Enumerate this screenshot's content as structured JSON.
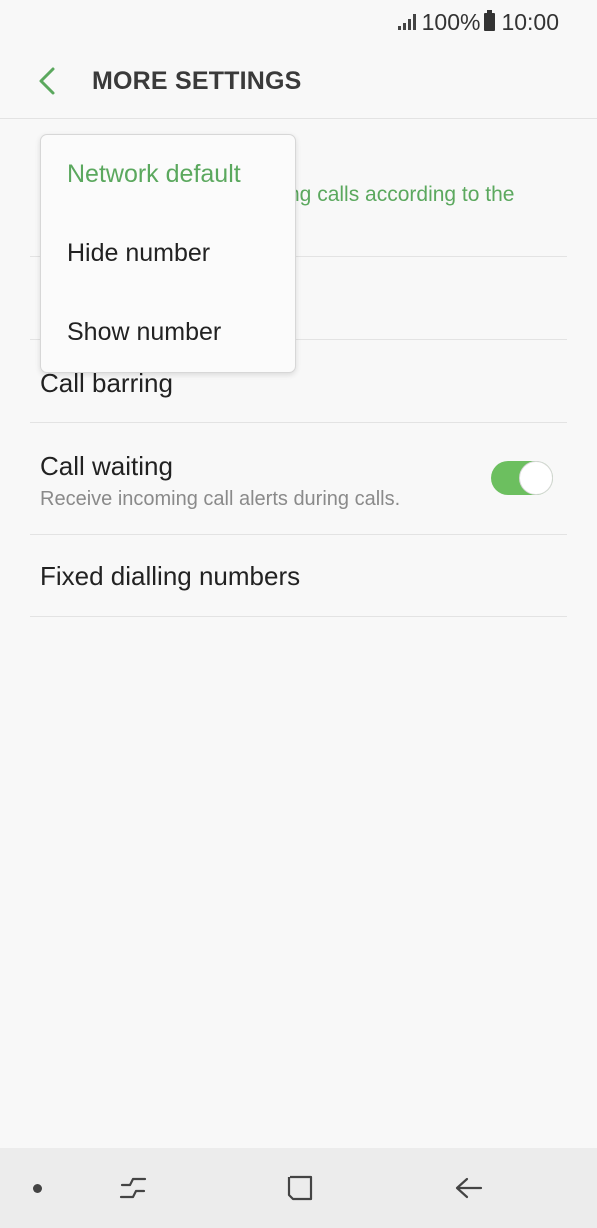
{
  "status_bar": {
    "battery": "100%",
    "time": "10:00"
  },
  "header": {
    "title": "MORE SETTINGS",
    "back_icon": "chevron-left-icon"
  },
  "settings": {
    "caller_id": {
      "subtitle_partial": "ng calls according to the"
    },
    "call_barring": {
      "title": "Call barring"
    },
    "call_waiting": {
      "title": "Call waiting",
      "subtitle": "Receive incoming call alerts during calls.",
      "enabled": true
    },
    "fixed_dialling": {
      "title": "Fixed dialling numbers"
    }
  },
  "dropdown": {
    "options": [
      "Network default",
      "Hide number",
      "Show number"
    ],
    "selected": "Network default"
  },
  "nav_bar": {
    "icons": [
      "recent-apps-icon",
      "home-icon",
      "back-icon"
    ]
  },
  "colors": {
    "accent": "#5ba85e",
    "toggle_on": "#6cbf5f",
    "background": "#f8f8f8"
  }
}
